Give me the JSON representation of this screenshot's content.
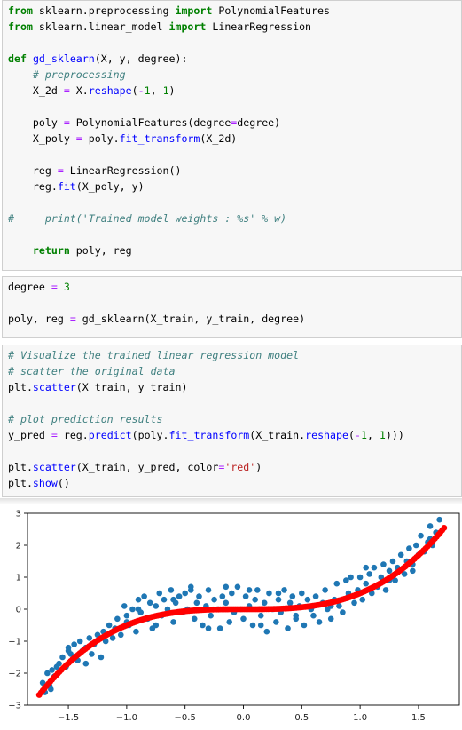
{
  "cells": [
    {
      "lines": [
        [
          [
            "k",
            "from"
          ],
          [
            "p",
            " sklearn.preprocessing "
          ],
          [
            "k",
            "import"
          ],
          [
            "p",
            " PolynomialFeatures"
          ]
        ],
        [
          [
            "k",
            "from"
          ],
          [
            "p",
            " sklearn.linear_model "
          ],
          [
            "k",
            "import"
          ],
          [
            "p",
            " LinearRegression"
          ]
        ],
        [],
        [
          [
            "k",
            "def"
          ],
          [
            "p",
            " "
          ],
          [
            "f",
            "gd_sklearn"
          ],
          [
            "p",
            "(X, y, degree):"
          ]
        ],
        [
          [
            "p",
            "    "
          ],
          [
            "c",
            "# preprocessing"
          ]
        ],
        [
          [
            "p",
            "    X_2d "
          ],
          [
            "o",
            "="
          ],
          [
            "p",
            " X."
          ],
          [
            "f",
            "reshape"
          ],
          [
            "p",
            "("
          ],
          [
            "o",
            "-"
          ],
          [
            "n",
            "1"
          ],
          [
            "p",
            ", "
          ],
          [
            "n",
            "1"
          ],
          [
            "p",
            ")"
          ]
        ],
        [],
        [
          [
            "p",
            "    poly "
          ],
          [
            "o",
            "="
          ],
          [
            "p",
            " PolynomialFeatures(degree"
          ],
          [
            "o",
            "="
          ],
          [
            "p",
            "degree)"
          ]
        ],
        [
          [
            "p",
            "    X_poly "
          ],
          [
            "o",
            "="
          ],
          [
            "p",
            " poly."
          ],
          [
            "f",
            "fit_transform"
          ],
          [
            "p",
            "(X_2d)"
          ]
        ],
        [],
        [
          [
            "p",
            "    reg "
          ],
          [
            "o",
            "="
          ],
          [
            "p",
            " LinearRegression()"
          ]
        ],
        [
          [
            "p",
            "    reg."
          ],
          [
            "f",
            "fit"
          ],
          [
            "p",
            "(X_poly, y)"
          ]
        ],
        [],
        [
          [
            "c",
            "#     print('Trained model weights : %s' % w)"
          ]
        ],
        [],
        [
          [
            "p",
            "    "
          ],
          [
            "k",
            "return"
          ],
          [
            "p",
            " poly, reg"
          ]
        ]
      ]
    },
    {
      "lines": [
        [
          [
            "p",
            "degree "
          ],
          [
            "o",
            "="
          ],
          [
            "p",
            " "
          ],
          [
            "n",
            "3"
          ]
        ],
        [],
        [
          [
            "p",
            "poly, reg "
          ],
          [
            "o",
            "="
          ],
          [
            "p",
            " gd_sklearn(X_train, y_train, degree)"
          ]
        ]
      ]
    },
    {
      "lines": [
        [
          [
            "c",
            "# Visualize the trained linear regression model"
          ]
        ],
        [
          [
            "c",
            "# scatter the original data"
          ]
        ],
        [
          [
            "p",
            "plt."
          ],
          [
            "f",
            "scatter"
          ],
          [
            "p",
            "(X_train, y_train)"
          ]
        ],
        [],
        [
          [
            "c",
            "# plot prediction results"
          ]
        ],
        [
          [
            "p",
            "y_pred "
          ],
          [
            "o",
            "="
          ],
          [
            "p",
            " reg."
          ],
          [
            "f",
            "predict"
          ],
          [
            "p",
            "(poly."
          ],
          [
            "f",
            "fit_transform"
          ],
          [
            "p",
            "(X_train."
          ],
          [
            "f",
            "reshape"
          ],
          [
            "p",
            "("
          ],
          [
            "o",
            "-"
          ],
          [
            "n",
            "1"
          ],
          [
            "p",
            ", "
          ],
          [
            "n",
            "1"
          ],
          [
            "p",
            ")))"
          ]
        ],
        [],
        [
          [
            "p",
            "plt."
          ],
          [
            "f",
            "scatter"
          ],
          [
            "p",
            "(X_train, y_pred, color"
          ],
          [
            "o",
            "="
          ],
          [
            "s",
            "'red'"
          ],
          [
            "p",
            ")"
          ]
        ],
        [
          [
            "p",
            "plt."
          ],
          [
            "f",
            "show"
          ],
          [
            "p",
            "()"
          ]
        ]
      ]
    }
  ],
  "chart_data": {
    "type": "scatter",
    "title": "",
    "xlabel": "",
    "ylabel": "",
    "xlim": [
      -1.85,
      1.85
    ],
    "ylim": [
      -3.0,
      3.0
    ],
    "xticks": [
      "−1.5",
      "−1.0",
      "−0.5",
      "0.0",
      "0.5",
      "1.0",
      "1.5"
    ],
    "xtick_values": [
      -1.5,
      -1.0,
      -0.5,
      0.0,
      0.5,
      1.0,
      1.5
    ],
    "yticks": [
      "−3",
      "−2",
      "−1",
      "0",
      "1",
      "2",
      "3"
    ],
    "ytick_values": [
      -3,
      -2,
      -1,
      0,
      1,
      2,
      3
    ],
    "grid": false,
    "series": [
      {
        "color": "#1f77b4",
        "x": [
          -1.72,
          -1.7,
          -1.68,
          -1.66,
          -1.64,
          -1.62,
          -1.6,
          -1.58,
          -1.55,
          -1.52,
          -1.5,
          -1.48,
          -1.45,
          -1.42,
          -1.4,
          -1.38,
          -1.35,
          -1.32,
          -1.3,
          -1.28,
          -1.25,
          -1.22,
          -1.2,
          -1.18,
          -1.15,
          -1.12,
          -1.1,
          -1.08,
          -1.05,
          -1.02,
          -1.0,
          -0.98,
          -0.95,
          -0.92,
          -0.9,
          -0.88,
          -0.85,
          -0.82,
          -0.8,
          -0.78,
          -0.75,
          -0.72,
          -0.7,
          -0.68,
          -0.65,
          -0.62,
          -0.6,
          -0.58,
          -0.55,
          -0.52,
          -0.5,
          -0.48,
          -0.45,
          -0.42,
          -0.4,
          -0.38,
          -0.35,
          -0.32,
          -0.3,
          -0.28,
          -0.25,
          -0.22,
          -0.2,
          -0.18,
          -0.15,
          -0.12,
          -0.1,
          -0.08,
          -0.05,
          -0.02,
          0.0,
          0.02,
          0.05,
          0.08,
          0.1,
          0.12,
          0.15,
          0.18,
          0.2,
          0.22,
          0.25,
          0.28,
          0.3,
          0.32,
          0.35,
          0.38,
          0.4,
          0.42,
          0.45,
          0.48,
          0.5,
          0.52,
          0.55,
          0.58,
          0.6,
          0.62,
          0.65,
          0.68,
          0.7,
          0.72,
          0.75,
          0.78,
          0.8,
          0.82,
          0.85,
          0.88,
          0.9,
          0.92,
          0.95,
          0.98,
          1.0,
          1.02,
          1.05,
          1.08,
          1.1,
          1.12,
          1.15,
          1.18,
          1.2,
          1.22,
          1.25,
          1.28,
          1.3,
          1.32,
          1.35,
          1.38,
          1.4,
          1.42,
          1.45,
          1.48,
          1.5,
          1.52,
          1.55,
          1.58,
          1.6,
          1.62,
          1.65,
          1.68,
          -1.65,
          -1.5,
          -1.35,
          -1.2,
          -1.0,
          -0.9,
          -0.75,
          -0.6,
          -0.45,
          -0.3,
          -0.15,
          0.05,
          0.15,
          0.3,
          0.45,
          0.6,
          0.75,
          0.9,
          1.05,
          1.25,
          1.45,
          1.6
        ],
        "y": [
          -2.3,
          -2.6,
          -2.0,
          -2.4,
          -1.9,
          -2.1,
          -1.8,
          -1.7,
          -1.5,
          -1.8,
          -1.2,
          -1.4,
          -1.1,
          -1.6,
          -1.0,
          -1.3,
          -1.2,
          -0.9,
          -1.4,
          -1.1,
          -0.8,
          -1.5,
          -0.7,
          -1.0,
          -0.5,
          -0.9,
          -0.6,
          -0.3,
          -0.8,
          0.1,
          -0.2,
          -0.5,
          0.0,
          -0.7,
          0.3,
          -0.1,
          0.4,
          -0.3,
          0.2,
          -0.6,
          0.1,
          0.5,
          -0.2,
          0.3,
          0.0,
          0.6,
          -0.4,
          0.2,
          0.4,
          -0.1,
          0.5,
          0.0,
          0.7,
          -0.3,
          0.2,
          0.4,
          -0.5,
          0.1,
          0.6,
          -0.2,
          0.3,
          0.0,
          -0.6,
          0.4,
          0.2,
          -0.4,
          0.5,
          -0.1,
          0.7,
          0.0,
          -0.3,
          0.4,
          0.1,
          -0.5,
          0.3,
          0.6,
          -0.2,
          0.2,
          -0.7,
          0.5,
          0.0,
          -0.4,
          0.3,
          -0.1,
          0.6,
          -0.6,
          0.2,
          0.4,
          -0.3,
          0.1,
          0.5,
          -0.5,
          0.3,
          0.0,
          -0.2,
          0.4,
          -0.4,
          0.2,
          0.6,
          0.0,
          -0.3,
          0.3,
          0.8,
          0.1,
          -0.1,
          0.9,
          0.4,
          1.0,
          0.2,
          0.6,
          1.0,
          0.3,
          0.8,
          1.1,
          0.5,
          1.3,
          0.7,
          1.0,
          1.4,
          0.6,
          1.2,
          1.5,
          0.9,
          1.3,
          1.7,
          1.1,
          1.5,
          1.9,
          1.4,
          2.0,
          1.7,
          2.3,
          1.8,
          2.1,
          2.6,
          2.0,
          2.4,
          2.8,
          -2.5,
          -1.3,
          -1.7,
          -0.9,
          -0.4,
          0.0,
          -0.5,
          0.3,
          0.6,
          -0.6,
          0.7,
          0.6,
          -0.5,
          0.5,
          -0.2,
          0.1,
          0.1,
          0.5,
          1.3,
          0.9,
          1.2,
          2.2
        ],
        "name": ""
      },
      {
        "color": "#ff0000",
        "fit_coeffs": [
          0.0,
          0.0,
          0.0,
          0.5
        ],
        "x_range": [
          -1.75,
          1.72
        ],
        "n": 220,
        "name": ""
      }
    ]
  }
}
